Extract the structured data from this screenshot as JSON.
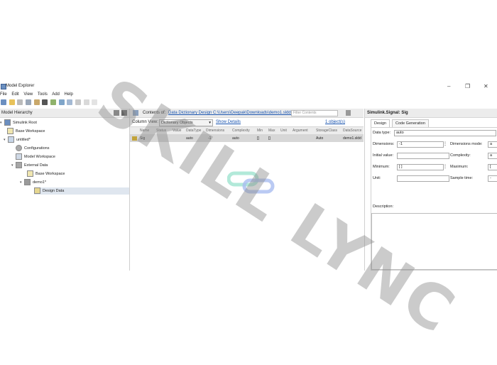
{
  "window": {
    "title": "Model Explorer",
    "controls": [
      "–",
      "❐",
      "✕"
    ]
  },
  "menu": [
    "File",
    "Edit",
    "View",
    "Tools",
    "Add",
    "Help"
  ],
  "left_pane": {
    "header": "Model Hierarchy",
    "tree": [
      {
        "label": "Simulink Root",
        "level": 0,
        "icon": "simulink-root-icon",
        "expanded": true
      },
      {
        "label": "Base Workspace",
        "level": 1,
        "icon": "workspace-icon"
      },
      {
        "label": "untitled*",
        "level": 1,
        "icon": "model-icon",
        "expanded": true
      },
      {
        "label": "Configurations",
        "level": 2,
        "icon": "config-icon"
      },
      {
        "label": "Model Workspace",
        "level": 2,
        "icon": "workspace-icon"
      },
      {
        "label": "External Data",
        "level": 2,
        "icon": "external-data-icon",
        "expanded": true
      },
      {
        "label": "Base Workspace",
        "level": 3,
        "icon": "workspace-icon"
      },
      {
        "label": "demo1*",
        "level": 3,
        "icon": "dictionary-icon",
        "expanded": true
      },
      {
        "label": "Design Data",
        "level": 4,
        "icon": "design-data-icon",
        "selected": true
      }
    ]
  },
  "middle_pane": {
    "contents_label": "Contents of:",
    "contents_path": "Data Dictionary Design  C:\\Users\\Deepak\\Downloads\\demo1.sldd  (only)",
    "filter_placeholder": "Filter Contents",
    "object_count": "1 object(s)",
    "column_view_label": "Column View:",
    "column_view_value": "Dictionary Objects",
    "show_details": "Show Details",
    "columns": [
      "Name",
      "Status",
      "Value",
      "DataType",
      "Dimensions",
      "Complexity",
      "Min",
      "Max",
      "Unit",
      "Argument",
      "StorageClass",
      "DataSource"
    ],
    "rows": [
      {
        "Name": "Sig",
        "Status": "",
        "Value": "",
        "DataType": "auto",
        "Dimensions": "-1",
        "Complexity": "auto",
        "Min": "[]",
        "Max": "[]",
        "Unit": "",
        "Argument": "",
        "StorageClass": "Auto",
        "DataSource": "demo1.sldd"
      }
    ]
  },
  "right_pane": {
    "title": "Simulink.Signal: Sig",
    "tabs": [
      "Design",
      "Code Generation"
    ],
    "fields": {
      "data_type_label": "Data type:",
      "data_type_value": "auto",
      "dimensions_label": "Dimensions:",
      "dimensions_value": "-1",
      "dimensions_mode_label": "Dimensions mode:",
      "dimensions_mode_value": "a",
      "initial_value_label": "Initial value:",
      "initial_value_value": "",
      "complexity_label": "Complexity:",
      "complexity_value": "a",
      "minimum_label": "Minimum:",
      "minimum_value": "[ ]",
      "maximum_label": "Maximum:",
      "maximum_value": "[",
      "unit_label": "Unit:",
      "unit_value": "",
      "sample_time_label": "Sample time:",
      "sample_time_value": "-",
      "description_label": "Description:"
    }
  },
  "watermark": "SKILL LYNC",
  "colors": {
    "accent": "#1a55b0",
    "selection": "#dfe6ef",
    "row": "#d7d7d7",
    "progress": "#3e86e0"
  }
}
